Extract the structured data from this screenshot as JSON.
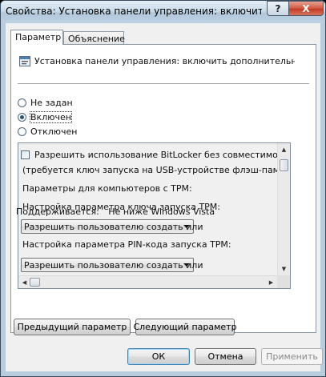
{
  "window": {
    "title": "Свойства: Установка панели управления: включить допо...",
    "help_label": "?",
    "close_label": "X"
  },
  "tabs": [
    {
      "label": "Параметр",
      "active": true
    },
    {
      "label": "Объяснение",
      "active": false
    }
  ],
  "policy": {
    "icon": "policy-setting-icon",
    "name": "Установка панели управления: включить дополнительные пара..."
  },
  "states": [
    {
      "label": "Не задан",
      "checked": false
    },
    {
      "label": "Включен",
      "checked": true
    },
    {
      "label": "Отключен",
      "checked": false
    }
  ],
  "options": {
    "allow_bitlocker_checkbox": "Разрешить использование BitLocker без совместимого TPM",
    "allow_bitlocker_note": "(требуется ключ запуска на USB-устройстве флэш-памяти)",
    "tpm_params_heading": "Параметры для компьютеров с TPM:",
    "startup_key_label": "Настройка параметра ключа запуска TPM:",
    "startup_key_value": "Разрешить пользователю создать или",
    "pin_label": "Настройка параметра PIN-кода запуска TPM:",
    "pin_value": "Разрешить пользователю создать или"
  },
  "supported": {
    "label": "Поддерживается:",
    "value": "Не ниже Windows Vista"
  },
  "nav_buttons": {
    "prev": "Предыдущий параметр",
    "next": "Следующий параметр"
  },
  "dialog_buttons": {
    "ok": "ОК",
    "cancel": "Отмена",
    "apply": "Применить"
  },
  "colors": {
    "frame": "#b7ccdc",
    "close_button": "#c33b24",
    "dialog_bg": "#f0f0f0"
  }
}
